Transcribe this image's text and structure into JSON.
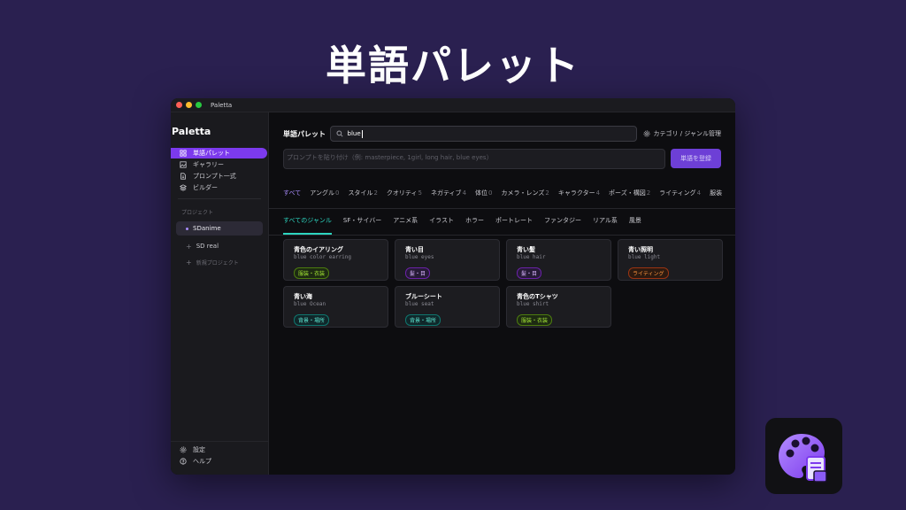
{
  "hero": {
    "title": "単語パレット"
  },
  "window": {
    "title": "Paletta"
  },
  "sidebar": {
    "brand": "Paletta",
    "nav": [
      {
        "label": "単語パレット",
        "icon": "grid-icon"
      },
      {
        "label": "ギャラリー",
        "icon": "image-icon"
      },
      {
        "label": "プロンプト一式",
        "icon": "document-icon"
      },
      {
        "label": "ビルダー",
        "icon": "layers-icon"
      }
    ],
    "projects_label": "プロジェクト",
    "projects": [
      {
        "label": "SDanime"
      },
      {
        "label": "SD real"
      }
    ],
    "new_project": "新規プロジェクト",
    "bottom": [
      {
        "label": "設定",
        "icon": "gear-icon"
      },
      {
        "label": "ヘルプ",
        "icon": "help-icon"
      }
    ]
  },
  "main": {
    "title": "単語パレット",
    "search_value": "blue",
    "category_manage": "カテゴリ / ジャンル管理",
    "prompt_placeholder": "プロンプトを貼り付け（例: masterpiece, 1girl, long hair, blue eyes）",
    "register_button": "単語を登録",
    "tabs": [
      {
        "label": "すべて",
        "count": ""
      },
      {
        "label": "アングル",
        "count": "0"
      },
      {
        "label": "スタイル",
        "count": "2"
      },
      {
        "label": "クオリティ",
        "count": "5"
      },
      {
        "label": "ネガティブ",
        "count": "4"
      },
      {
        "label": "体位",
        "count": "0"
      },
      {
        "label": "カメラ・レンズ",
        "count": "2"
      },
      {
        "label": "キャラクター",
        "count": "4"
      },
      {
        "label": "ポーズ・構図",
        "count": "2"
      },
      {
        "label": "ライティング",
        "count": "4"
      },
      {
        "label": "服装",
        "count": ""
      }
    ],
    "genres": [
      "すべてのジャンル",
      "SF・サイバー",
      "アニメ系",
      "イラスト",
      "ホラー",
      "ポートレート",
      "ファンタジー",
      "リアル系",
      "風景"
    ],
    "cards": [
      {
        "title": "青色のイアリング",
        "sub": "blue color earring",
        "tag": "服装・衣装",
        "tag_color": "green"
      },
      {
        "title": "青い目",
        "sub": "blue eyes",
        "tag": "髪・目",
        "tag_color": "purple"
      },
      {
        "title": "青い髪",
        "sub": "blue hair",
        "tag": "髪・目",
        "tag_color": "purple"
      },
      {
        "title": "青い照明",
        "sub": "blue light",
        "tag": "ライティング",
        "tag_color": "orange"
      },
      {
        "title": "青い海",
        "sub": "blue Ocean",
        "tag": "背景・場所",
        "tag_color": "teal"
      },
      {
        "title": "ブルーシート",
        "sub": "blue seat",
        "tag": "背景・場所",
        "tag_color": "teal"
      },
      {
        "title": "青色のTシャツ",
        "sub": "blue shirt",
        "tag": "服装・衣装",
        "tag_color": "green"
      }
    ]
  },
  "colors": {
    "accent": "#7c3aed",
    "genre_accent": "#2dd4bf",
    "background": "#2a2050"
  },
  "app_icon": "palette-document-icon"
}
